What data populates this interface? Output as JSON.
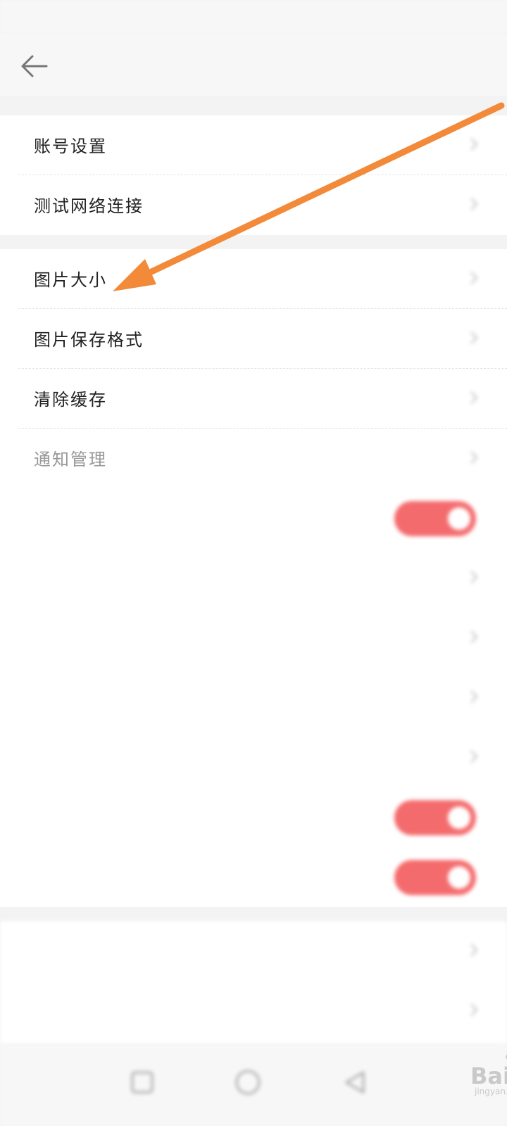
{
  "status_bar": {
    "left": "",
    "right": ""
  },
  "header": {
    "title": "",
    "back_icon": "arrow-left-icon"
  },
  "settings": {
    "group1": [
      {
        "label": "账号设置"
      },
      {
        "label": "测试网络连接"
      }
    ],
    "group2": [
      {
        "label": "图片大小",
        "value": ""
      },
      {
        "label": "图片保存格式",
        "value": ""
      },
      {
        "label": "清除缓存"
      },
      {
        "label": "通知管理"
      },
      {
        "label": "",
        "toggle_on": true
      },
      {
        "label": "",
        "value": ""
      },
      {
        "label": "",
        "value": ""
      },
      {
        "label": "",
        "value": ""
      },
      {
        "label": "",
        "value": ""
      },
      {
        "label": "",
        "toggle_on": true
      },
      {
        "label": "",
        "toggle_on": true
      }
    ],
    "group3": [
      {
        "label": ""
      },
      {
        "label": "",
        "value": ""
      }
    ]
  },
  "colors": {
    "toggle_on": "#f46b6d",
    "annotation_arrow": "#f28a3a"
  },
  "watermark": {
    "text": "Baidu经验",
    "sub": "jingyan.baidu.com"
  }
}
